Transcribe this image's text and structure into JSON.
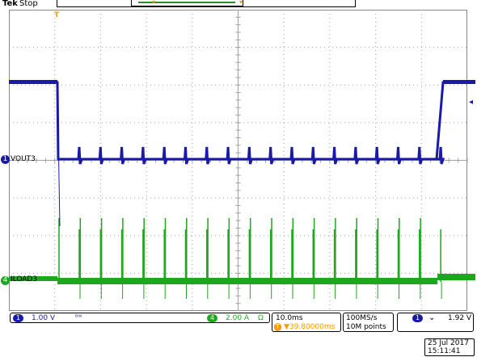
{
  "header": {
    "brand": "Tek",
    "run_state": "Stop"
  },
  "channels": [
    {
      "id": "1",
      "name": "VOUT3",
      "color": "#1a1aa6",
      "scale": "1.00 V",
      "coupling_icon": "bw-limit-icon"
    },
    {
      "id": "4",
      "name": "ILOAD3",
      "color": "#1fa61f",
      "scale": "2.00 A",
      "unit_symbol": "Ω"
    }
  ],
  "timebase": {
    "scale": "10.0ms",
    "trigger_position": "▼39.80000ms",
    "trigger_position_prefix": "T",
    "sample_rate": "100MS/s",
    "record_length": "10M points"
  },
  "trigger": {
    "source": "1",
    "slope_icon": "falling-edge-icon",
    "level": "1.92 V",
    "marker": "T"
  },
  "datetime": {
    "date": "25 Jul  2017",
    "time": "15:11:41"
  },
  "colors": {
    "grid": "#a0a0a0",
    "trigger": "#ff9a00"
  }
}
